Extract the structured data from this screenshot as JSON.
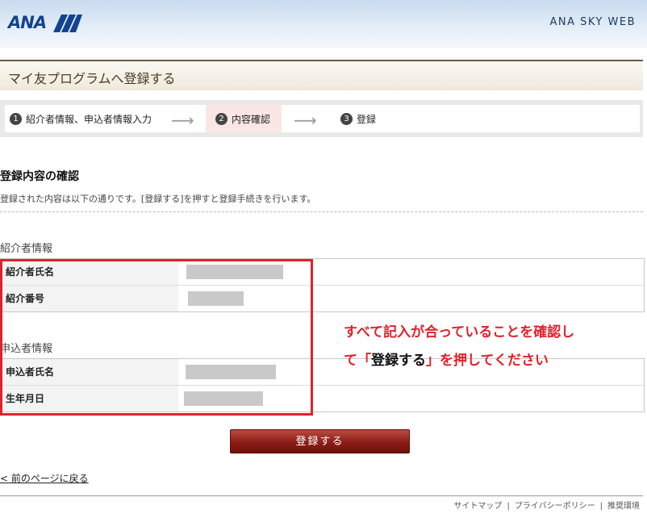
{
  "header": {
    "logo_text": "ANA",
    "brand": "ANA SKY WEB"
  },
  "page_title": "マイ友プログラムへ登録する",
  "steps": [
    {
      "num": "1",
      "label": "紹介者情報、申込者情報入力"
    },
    {
      "num": "2",
      "label": "内容確認"
    },
    {
      "num": "3",
      "label": "登録"
    }
  ],
  "arrow": "⟶",
  "confirm": {
    "title": "登録内容の確認",
    "desc": "登録された内容は以下の通りです。[登録する]を押すと登録手続きを行います。"
  },
  "introducer": {
    "heading": "紹介者情報",
    "name_label": "紹介者氏名",
    "number_label": "紹介番号"
  },
  "applicant": {
    "heading": "申込者情報",
    "name_label": "申込者氏名",
    "birth_label": "生年月日"
  },
  "annotation": {
    "line1": "すべて記入が合っていることを確認し",
    "line2_pre": "て「",
    "line2_bold": "登録する",
    "line2_post": "」を押してください"
  },
  "register_button": "登録する",
  "back_link": "< 前のページに戻る",
  "footer": {
    "links": [
      "サイトマップ",
      "プライバシーポリシー",
      "推奨環境"
    ],
    "separator": "|"
  },
  "colors": {
    "accent_red": "#e0222c",
    "brand_blue": "#13448f",
    "button_red": "#8c1c17"
  }
}
